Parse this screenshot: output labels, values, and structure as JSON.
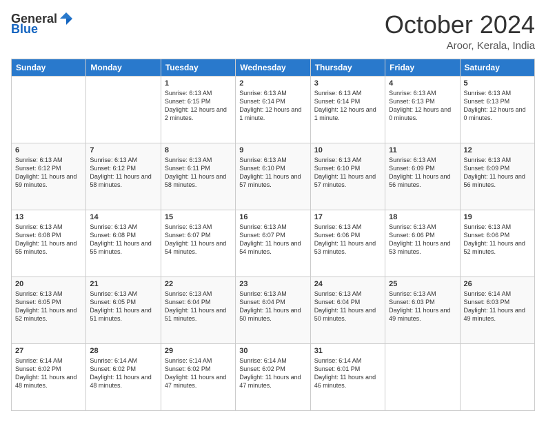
{
  "header": {
    "logo_general": "General",
    "logo_blue": "Blue",
    "month_title": "October 2024",
    "location": "Aroor, Kerala, India"
  },
  "days_of_week": [
    "Sunday",
    "Monday",
    "Tuesday",
    "Wednesday",
    "Thursday",
    "Friday",
    "Saturday"
  ],
  "weeks": [
    [
      {
        "day": "",
        "sunrise": "",
        "sunset": "",
        "daylight": ""
      },
      {
        "day": "",
        "sunrise": "",
        "sunset": "",
        "daylight": ""
      },
      {
        "day": "1",
        "sunrise": "Sunrise: 6:13 AM",
        "sunset": "Sunset: 6:15 PM",
        "daylight": "Daylight: 12 hours and 2 minutes."
      },
      {
        "day": "2",
        "sunrise": "Sunrise: 6:13 AM",
        "sunset": "Sunset: 6:14 PM",
        "daylight": "Daylight: 12 hours and 1 minute."
      },
      {
        "day": "3",
        "sunrise": "Sunrise: 6:13 AM",
        "sunset": "Sunset: 6:14 PM",
        "daylight": "Daylight: 12 hours and 1 minute."
      },
      {
        "day": "4",
        "sunrise": "Sunrise: 6:13 AM",
        "sunset": "Sunset: 6:13 PM",
        "daylight": "Daylight: 12 hours and 0 minutes."
      },
      {
        "day": "5",
        "sunrise": "Sunrise: 6:13 AM",
        "sunset": "Sunset: 6:13 PM",
        "daylight": "Daylight: 12 hours and 0 minutes."
      }
    ],
    [
      {
        "day": "6",
        "sunrise": "Sunrise: 6:13 AM",
        "sunset": "Sunset: 6:12 PM",
        "daylight": "Daylight: 11 hours and 59 minutes."
      },
      {
        "day": "7",
        "sunrise": "Sunrise: 6:13 AM",
        "sunset": "Sunset: 6:12 PM",
        "daylight": "Daylight: 11 hours and 58 minutes."
      },
      {
        "day": "8",
        "sunrise": "Sunrise: 6:13 AM",
        "sunset": "Sunset: 6:11 PM",
        "daylight": "Daylight: 11 hours and 58 minutes."
      },
      {
        "day": "9",
        "sunrise": "Sunrise: 6:13 AM",
        "sunset": "Sunset: 6:10 PM",
        "daylight": "Daylight: 11 hours and 57 minutes."
      },
      {
        "day": "10",
        "sunrise": "Sunrise: 6:13 AM",
        "sunset": "Sunset: 6:10 PM",
        "daylight": "Daylight: 11 hours and 57 minutes."
      },
      {
        "day": "11",
        "sunrise": "Sunrise: 6:13 AM",
        "sunset": "Sunset: 6:09 PM",
        "daylight": "Daylight: 11 hours and 56 minutes."
      },
      {
        "day": "12",
        "sunrise": "Sunrise: 6:13 AM",
        "sunset": "Sunset: 6:09 PM",
        "daylight": "Daylight: 11 hours and 56 minutes."
      }
    ],
    [
      {
        "day": "13",
        "sunrise": "Sunrise: 6:13 AM",
        "sunset": "Sunset: 6:08 PM",
        "daylight": "Daylight: 11 hours and 55 minutes."
      },
      {
        "day": "14",
        "sunrise": "Sunrise: 6:13 AM",
        "sunset": "Sunset: 6:08 PM",
        "daylight": "Daylight: 11 hours and 55 minutes."
      },
      {
        "day": "15",
        "sunrise": "Sunrise: 6:13 AM",
        "sunset": "Sunset: 6:07 PM",
        "daylight": "Daylight: 11 hours and 54 minutes."
      },
      {
        "day": "16",
        "sunrise": "Sunrise: 6:13 AM",
        "sunset": "Sunset: 6:07 PM",
        "daylight": "Daylight: 11 hours and 54 minutes."
      },
      {
        "day": "17",
        "sunrise": "Sunrise: 6:13 AM",
        "sunset": "Sunset: 6:06 PM",
        "daylight": "Daylight: 11 hours and 53 minutes."
      },
      {
        "day": "18",
        "sunrise": "Sunrise: 6:13 AM",
        "sunset": "Sunset: 6:06 PM",
        "daylight": "Daylight: 11 hours and 53 minutes."
      },
      {
        "day": "19",
        "sunrise": "Sunrise: 6:13 AM",
        "sunset": "Sunset: 6:06 PM",
        "daylight": "Daylight: 11 hours and 52 minutes."
      }
    ],
    [
      {
        "day": "20",
        "sunrise": "Sunrise: 6:13 AM",
        "sunset": "Sunset: 6:05 PM",
        "daylight": "Daylight: 11 hours and 52 minutes."
      },
      {
        "day": "21",
        "sunrise": "Sunrise: 6:13 AM",
        "sunset": "Sunset: 6:05 PM",
        "daylight": "Daylight: 11 hours and 51 minutes."
      },
      {
        "day": "22",
        "sunrise": "Sunrise: 6:13 AM",
        "sunset": "Sunset: 6:04 PM",
        "daylight": "Daylight: 11 hours and 51 minutes."
      },
      {
        "day": "23",
        "sunrise": "Sunrise: 6:13 AM",
        "sunset": "Sunset: 6:04 PM",
        "daylight": "Daylight: 11 hours and 50 minutes."
      },
      {
        "day": "24",
        "sunrise": "Sunrise: 6:13 AM",
        "sunset": "Sunset: 6:04 PM",
        "daylight": "Daylight: 11 hours and 50 minutes."
      },
      {
        "day": "25",
        "sunrise": "Sunrise: 6:13 AM",
        "sunset": "Sunset: 6:03 PM",
        "daylight": "Daylight: 11 hours and 49 minutes."
      },
      {
        "day": "26",
        "sunrise": "Sunrise: 6:14 AM",
        "sunset": "Sunset: 6:03 PM",
        "daylight": "Daylight: 11 hours and 49 minutes."
      }
    ],
    [
      {
        "day": "27",
        "sunrise": "Sunrise: 6:14 AM",
        "sunset": "Sunset: 6:02 PM",
        "daylight": "Daylight: 11 hours and 48 minutes."
      },
      {
        "day": "28",
        "sunrise": "Sunrise: 6:14 AM",
        "sunset": "Sunset: 6:02 PM",
        "daylight": "Daylight: 11 hours and 48 minutes."
      },
      {
        "day": "29",
        "sunrise": "Sunrise: 6:14 AM",
        "sunset": "Sunset: 6:02 PM",
        "daylight": "Daylight: 11 hours and 47 minutes."
      },
      {
        "day": "30",
        "sunrise": "Sunrise: 6:14 AM",
        "sunset": "Sunset: 6:02 PM",
        "daylight": "Daylight: 11 hours and 47 minutes."
      },
      {
        "day": "31",
        "sunrise": "Sunrise: 6:14 AM",
        "sunset": "Sunset: 6:01 PM",
        "daylight": "Daylight: 11 hours and 46 minutes."
      },
      {
        "day": "",
        "sunrise": "",
        "sunset": "",
        "daylight": ""
      },
      {
        "day": "",
        "sunrise": "",
        "sunset": "",
        "daylight": ""
      }
    ]
  ]
}
